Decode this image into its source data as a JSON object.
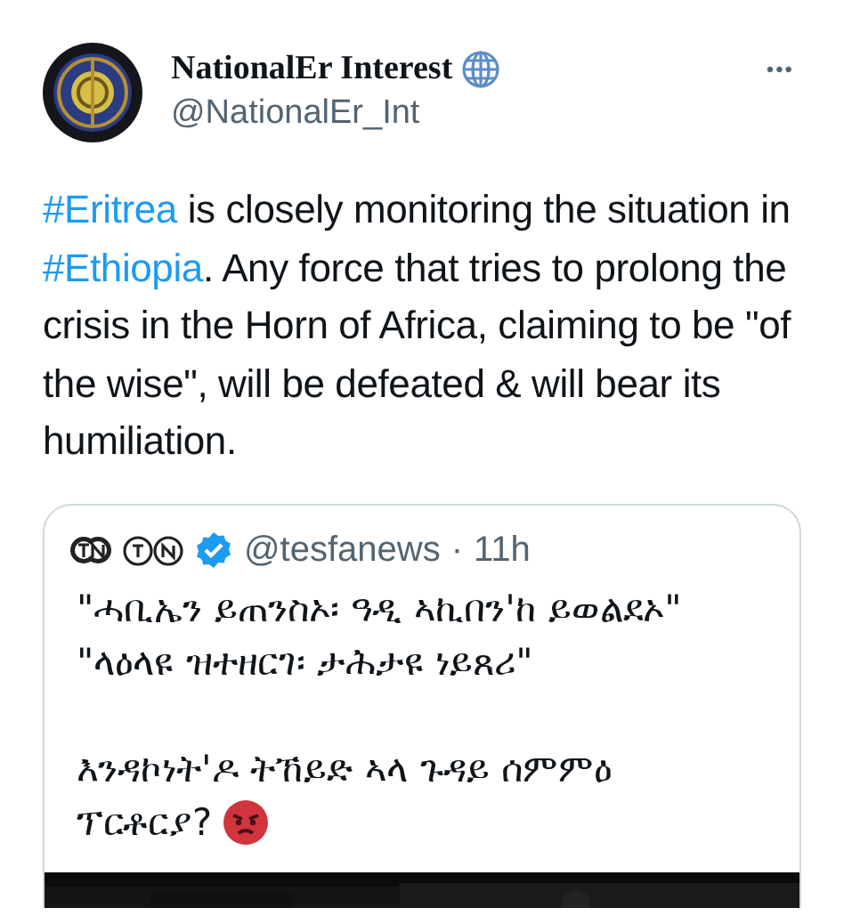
{
  "author": {
    "name": "NationalEr Interest",
    "handle": "@NationalEr_Int"
  },
  "more": "•••",
  "text": [
    {
      "kind": "hashtag",
      "text": "#Eritrea"
    },
    {
      "kind": "text",
      "text": " is closely monitoring the situation in "
    },
    {
      "kind": "hashtag",
      "text": "#Ethiopia"
    },
    {
      "kind": "text",
      "text": ". Any force that tries to prolong the crisis in the Horn of Africa, claiming to be \"of the wise\", will be defeated & will bear its humiliation."
    }
  ],
  "quote": {
    "verified": true,
    "handle": "@tesfanews",
    "separator": "·",
    "time": "11h",
    "paragraphs": [
      [
        "\"ሓቢኤን ይጠንስኦ፡ ዓዲ ኣኪበን'ከ ይወልደኦ\"",
        "\"ላዕላዩ ዝተዘርገ፡ ታሕታዩ ነይጸሪ\""
      ],
      [
        "እንዳኮነት'ዶ ትኸይድ ኣላ ጉዳይ ሰምምዕ",
        "ፕርቶርያ?"
      ]
    ]
  }
}
